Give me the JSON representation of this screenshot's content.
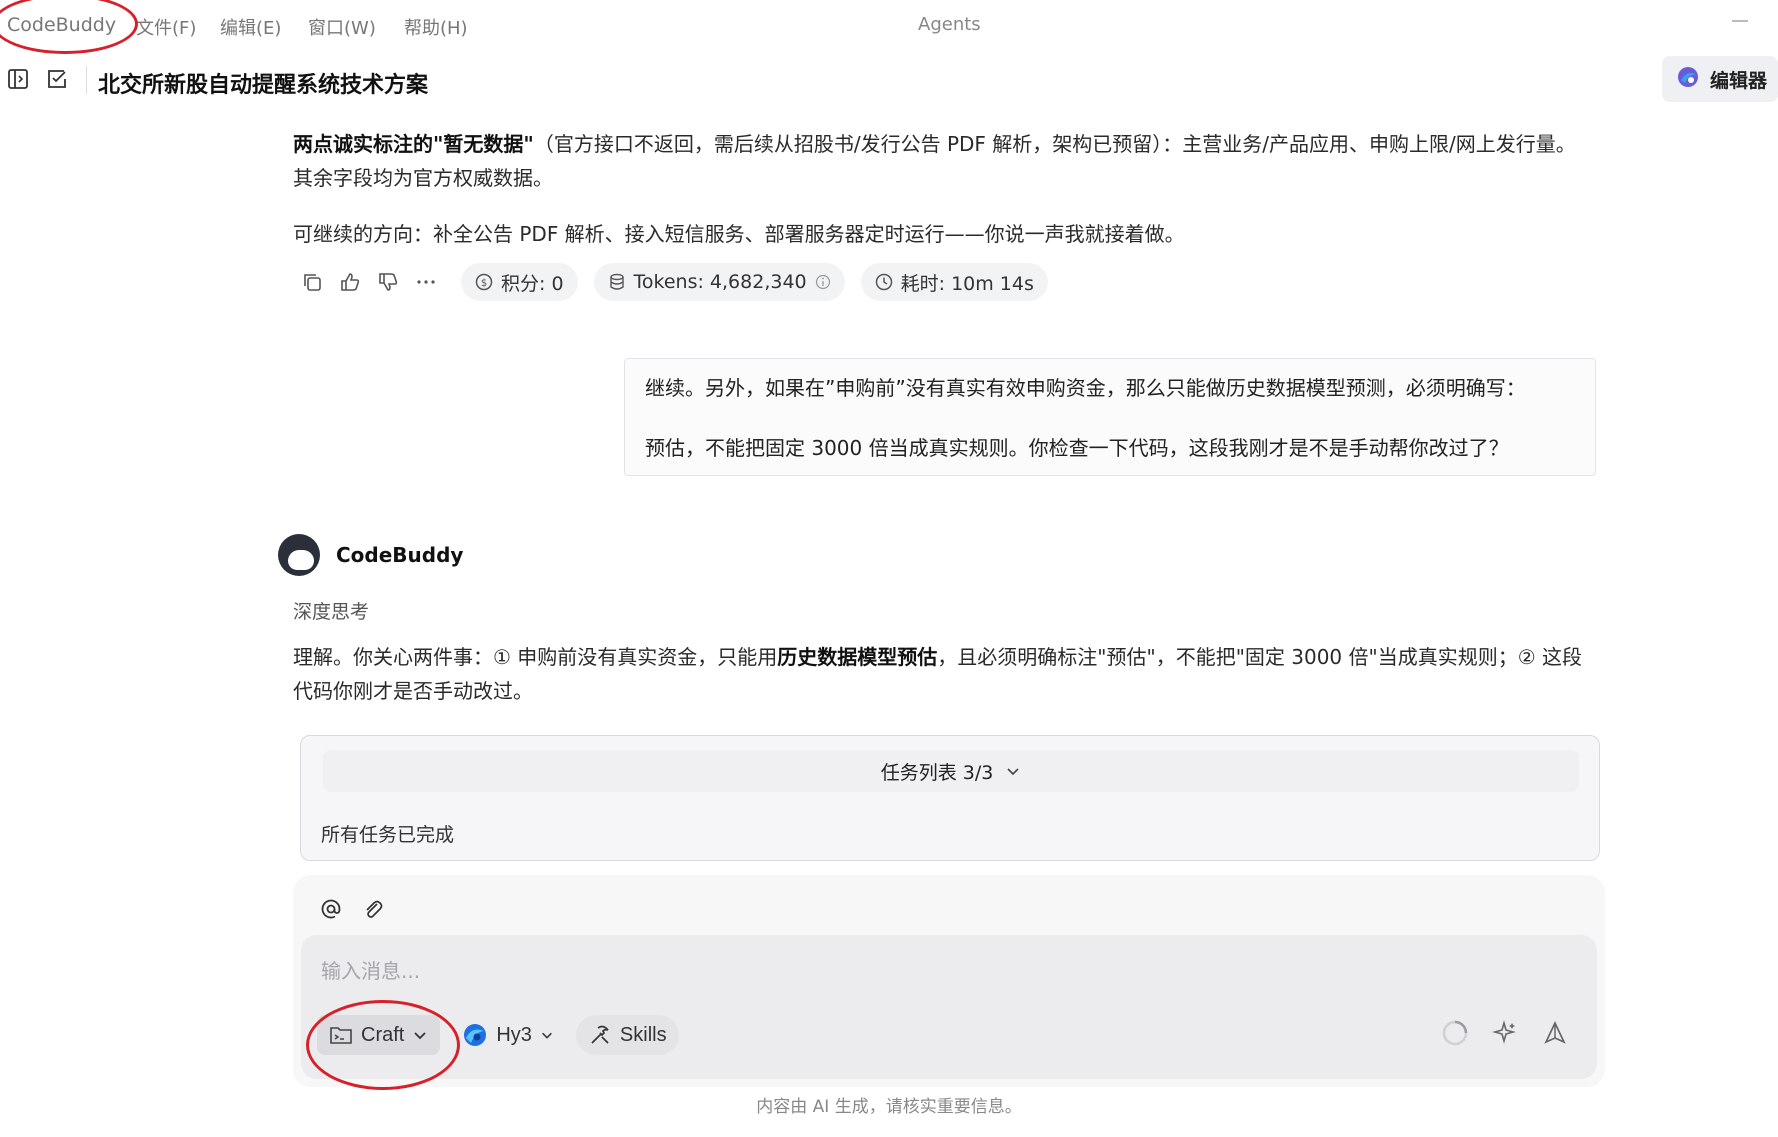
{
  "menubar": {
    "app_name": "CodeBuddy",
    "menus": [
      "文件(F)",
      "编辑(E)",
      "窗口(W)",
      "帮助(H)"
    ],
    "window_title": "Agents"
  },
  "header": {
    "doc_title": "北交所新股自动提醒系统技术方案",
    "editor_button": "编辑器"
  },
  "messages": {
    "p1_bold": "两点诚实标注的\"暂无数据\"",
    "p1_rest": "（官方接口不返回，需后续从招股书/发行公告 PDF 解析，架构已预留）：主营业务/产品应用、申购上限/网上发行量。其余字段均为官方权威数据。",
    "p2": "可继续的方向：补全公告 PDF 解析、接入短信服务、部署服务器定时运行——你说一声我就接着做。",
    "stats": {
      "points": "积分: 0",
      "tokens": "Tokens: 4,682,340",
      "duration": "耗时: 10m 14s"
    },
    "user_line1": "继续。另外，如果在”申购前”没有真实有效申购资金，那么只能做历史数据模型预测，必须明确写：",
    "user_line2": "预估，不能把固定 3000 倍当成真实规则。你检查一下代码，这段我刚才是不是手动帮你改过了？",
    "bot_name": "CodeBuddy",
    "think_label": "深度思考",
    "bot_pre": "理解。你关心两件事：① 申购前没有真实资金，只能用",
    "bot_bold": "历史数据模型预估",
    "bot_post": "，且必须明确标注\"预估\"，不能把\"固定 3000 倍\"当成真实规则；② 这段代码你刚才是否手动改过。"
  },
  "tasks": {
    "header": "任务列表 3/3",
    "status": "所有任务已完成"
  },
  "composer": {
    "placeholder": "输入消息...",
    "mode": "Craft",
    "model": "Hy3",
    "skills": "Skills"
  },
  "disclaimer": "内容由 AI 生成，请核实重要信息。",
  "colors": {
    "annotation_red": "#d6202a",
    "model_icon_blue": "#1e6fe0"
  }
}
